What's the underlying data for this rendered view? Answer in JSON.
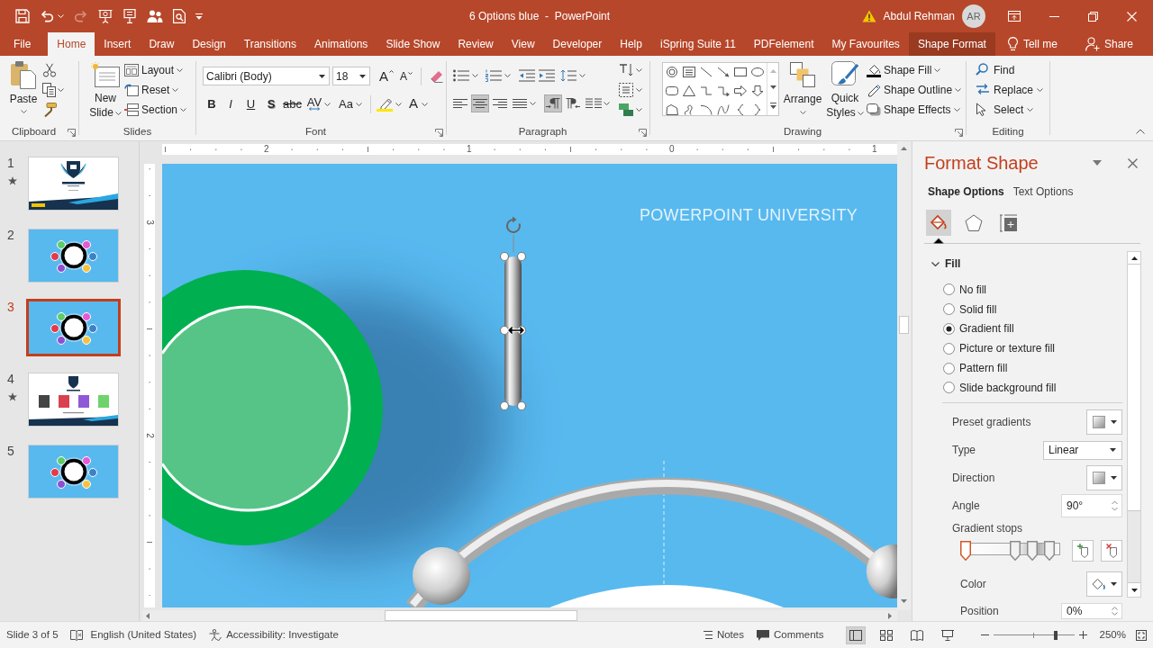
{
  "window": {
    "title": "6 Options blue  -  PowerPoint",
    "user_name": "Abdul Rehman",
    "avatar_initials": "AR"
  },
  "quick_access": [
    {
      "kind": "save",
      "disabled": false
    },
    {
      "kind": "undo",
      "disabled": false
    },
    {
      "kind": "redo",
      "disabled": true
    },
    {
      "kind": "present",
      "disabled": false
    },
    {
      "kind": "presenter",
      "disabled": false
    },
    {
      "kind": "share",
      "disabled": false
    },
    {
      "kind": "preview",
      "disabled": false
    },
    {
      "kind": "customize",
      "disabled": false
    }
  ],
  "tabs": [
    {
      "label": "File",
      "selected": false,
      "kind": "plain"
    },
    {
      "label": "Home",
      "selected": true,
      "kind": "plain"
    },
    {
      "label": "Insert",
      "selected": false,
      "kind": "plain"
    },
    {
      "label": "Draw",
      "selected": false,
      "kind": "plain"
    },
    {
      "label": "Design",
      "selected": false,
      "kind": "plain"
    },
    {
      "label": "Transitions",
      "selected": false,
      "kind": "plain"
    },
    {
      "label": "Animations",
      "selected": false,
      "kind": "plain"
    },
    {
      "label": "Slide Show",
      "selected": false,
      "kind": "plain"
    },
    {
      "label": "Review",
      "selected": false,
      "kind": "plain"
    },
    {
      "label": "View",
      "selected": false,
      "kind": "plain"
    },
    {
      "label": "Developer",
      "selected": false,
      "kind": "plain"
    },
    {
      "label": "Help",
      "selected": false,
      "kind": "plain"
    },
    {
      "label": "iSpring Suite 11",
      "selected": false,
      "kind": "plain"
    },
    {
      "label": "PDFelement",
      "selected": false,
      "kind": "plain"
    },
    {
      "label": "My Favourites",
      "selected": false,
      "kind": "plain"
    },
    {
      "label": "Shape Format",
      "selected": false,
      "kind": "contextual"
    }
  ],
  "tell_me": "Tell me",
  "share": "Share",
  "ribbon": {
    "clipboard": {
      "label": "Clipboard",
      "paste": "Paste"
    },
    "slides": {
      "label": "Slides",
      "new_slide": "New Slide",
      "buttons": [
        "Layout",
        "Reset",
        "Section"
      ]
    },
    "font": {
      "label": "Font",
      "font_name": "Calibri (Body)",
      "font_size": "18",
      "grow_font": "A",
      "shrink_font": "A",
      "format_buttons": [
        {
          "label": "B",
          "kind": "bold"
        },
        {
          "label": "I",
          "kind": "italic"
        },
        {
          "label": "U",
          "kind": "underline"
        },
        {
          "label": "S",
          "kind": "shadow"
        },
        {
          "label": "abc",
          "kind": "strike"
        },
        {
          "label": "AV",
          "kind": "spacing"
        },
        {
          "label": "Aa",
          "kind": "case"
        }
      ],
      "font_color": "A"
    },
    "paragraph": {
      "label": "Paragraph",
      "alignment": [
        {
          "kind": "left",
          "selected": false
        },
        {
          "kind": "center",
          "selected": true
        },
        {
          "kind": "right",
          "selected": false
        },
        {
          "kind": "justify",
          "selected": false
        }
      ],
      "direction": [
        {
          "kind": "ltr",
          "selected": true
        },
        {
          "kind": "rtl",
          "selected": false
        }
      ]
    },
    "drawing": {
      "label": "Drawing",
      "arrange": "Arrange",
      "quick_styles": "Quick Styles",
      "shape_buttons": [
        "Shape Fill",
        "Shape Outline",
        "Shape Effects"
      ]
    },
    "editing": {
      "label": "Editing",
      "buttons": [
        "Find",
        "Replace",
        "Select"
      ]
    }
  },
  "slides_pane": [
    {
      "number": "1",
      "selected": false,
      "animated": true,
      "kind": "title"
    },
    {
      "number": "2",
      "selected": false,
      "animated": false,
      "kind": "diagram"
    },
    {
      "number": "3",
      "selected": true,
      "animated": false,
      "kind": "diagram"
    },
    {
      "number": "4",
      "selected": false,
      "animated": true,
      "kind": "codes"
    },
    {
      "number": "5",
      "selected": false,
      "animated": false,
      "kind": "diagram"
    }
  ],
  "rulers": {
    "horizontal": [
      "2",
      "1",
      "0",
      "1"
    ],
    "vertical": [
      "3",
      "2"
    ]
  },
  "slide": {
    "brand_text": "POWERPOINT UNIVERSITY",
    "bar_selected": true
  },
  "format_pane": {
    "title": "Format Shape",
    "tabs": [
      {
        "label": "Shape Options",
        "selected": true
      },
      {
        "label": "Text Options",
        "selected": false
      }
    ],
    "icon_tabs": [
      {
        "kind": "fill",
        "selected": true
      },
      {
        "kind": "effects",
        "selected": false
      },
      {
        "kind": "size",
        "selected": false
      }
    ],
    "section": {
      "label": "Fill",
      "expanded": true
    },
    "fill_options": [
      {
        "label": "No fill",
        "selected": false
      },
      {
        "label": "Solid fill",
        "selected": false
      },
      {
        "label": "Gradient fill",
        "selected": true
      },
      {
        "label": "Picture or texture fill",
        "selected": false
      },
      {
        "label": "Pattern fill",
        "selected": false
      },
      {
        "label": "Slide background fill",
        "selected": false
      }
    ],
    "settings": [
      {
        "label": "Preset gradients",
        "kind": "swatch"
      },
      {
        "label": "Type",
        "kind": "dropdown",
        "value": "Linear"
      },
      {
        "label": "Direction",
        "kind": "swatch"
      },
      {
        "label": "Angle",
        "kind": "spinner",
        "value": "90°"
      }
    ],
    "gradient_stops": {
      "label": "Gradient stops",
      "stops": [
        {
          "level": 0,
          "selected": true
        },
        {
          "level": 0.55,
          "selected": false
        },
        {
          "level": 0.75,
          "selected": false
        },
        {
          "level": 0.94,
          "selected": false
        }
      ]
    },
    "color_label": "Color",
    "position": {
      "label": "Position",
      "value": "0%"
    }
  },
  "status_bar": {
    "slide_info": "Slide 3 of 5",
    "language": "English (United States)",
    "accessibility": "Accessibility: Investigate",
    "notes": "Notes",
    "comments": "Comments",
    "views": [
      {
        "kind": "normal",
        "selected": true
      },
      {
        "kind": "sorter",
        "selected": false
      },
      {
        "kind": "reading",
        "selected": false
      },
      {
        "kind": "slideshow",
        "selected": false
      }
    ],
    "zoom": {
      "level": 0.78,
      "reading": "250%"
    }
  }
}
